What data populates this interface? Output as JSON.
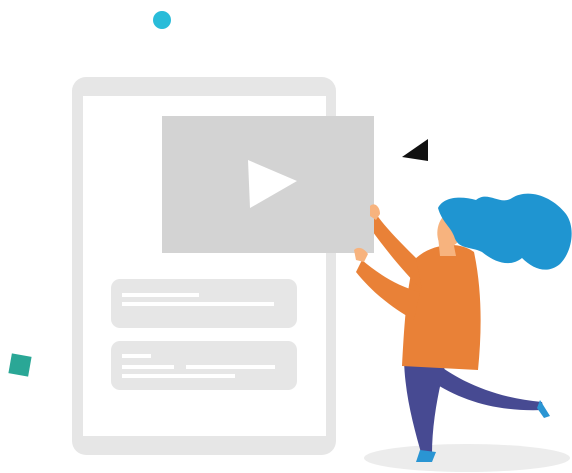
{
  "illustration": {
    "subject": "person-holding-video-player",
    "colors": {
      "tablet_frame": "#e6e6e6",
      "tablet_screen": "#ffffff",
      "card": "#e6e6e6",
      "card_line": "#ffffff",
      "video_panel": "#d3d3d3",
      "play_icon": "#ffffff",
      "dot": "#29bcd9",
      "square": "#2aa796",
      "triangle": "#111111",
      "hair": "#1f95d1",
      "skin": "#f7b37e",
      "shirt": "#e98137",
      "pants": "#474a92",
      "shoe": "#2a95d3",
      "shadow": "#ececec"
    },
    "icons": [
      "play-icon"
    ]
  }
}
